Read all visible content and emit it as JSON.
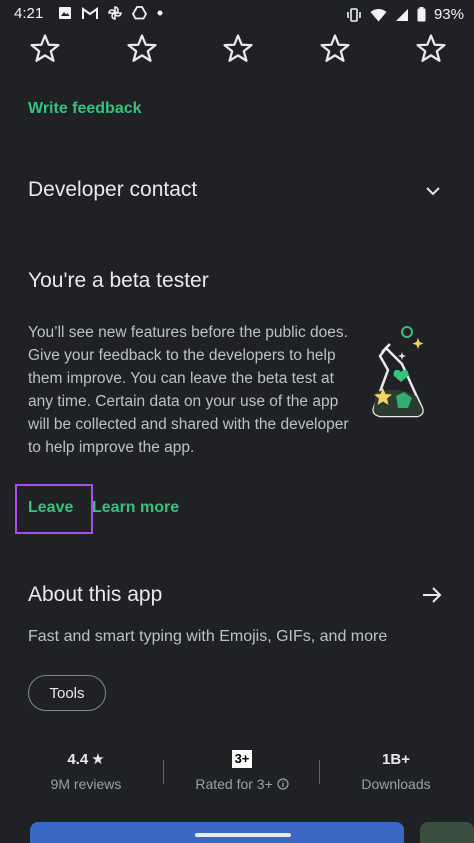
{
  "status_bar": {
    "time": "4:21",
    "battery": "93%",
    "left_icons": [
      "image-icon",
      "gmail-icon",
      "pinwheel-icon",
      "drive-icon",
      "dot-icon"
    ],
    "right_icons": [
      "vibrate-icon",
      "wifi-icon",
      "signal-icon",
      "battery-icon"
    ]
  },
  "rating": {
    "stars_total": 5,
    "stars_filled": 0
  },
  "feedback": {
    "write_feedback": "Write feedback"
  },
  "developer_contact": {
    "title": "Developer contact"
  },
  "beta": {
    "title": "You're a beta tester",
    "body": "You’ll see new features before the public does. Give your feedback to the developers to help them improve. You can leave the beta test at any time. Certain data on your use of the app will be collected and shared with the developer to help improve the app.",
    "leave": "Leave",
    "learn_more": "Learn more"
  },
  "about": {
    "title": "About this app",
    "description": "Fast and smart typing with Emojis, GIFs, and more",
    "tag": "Tools"
  },
  "stats": {
    "rating_value": "4.4",
    "rating_star": "★",
    "reviews": "9M reviews",
    "content_rating_badge": "3+",
    "content_rating_label": "Rated for 3+",
    "downloads_value": "1B+",
    "downloads_label": "Downloads"
  },
  "colors": {
    "background": "#202124",
    "accent_green": "#34c27d",
    "highlight_box": "#a64ee6"
  }
}
